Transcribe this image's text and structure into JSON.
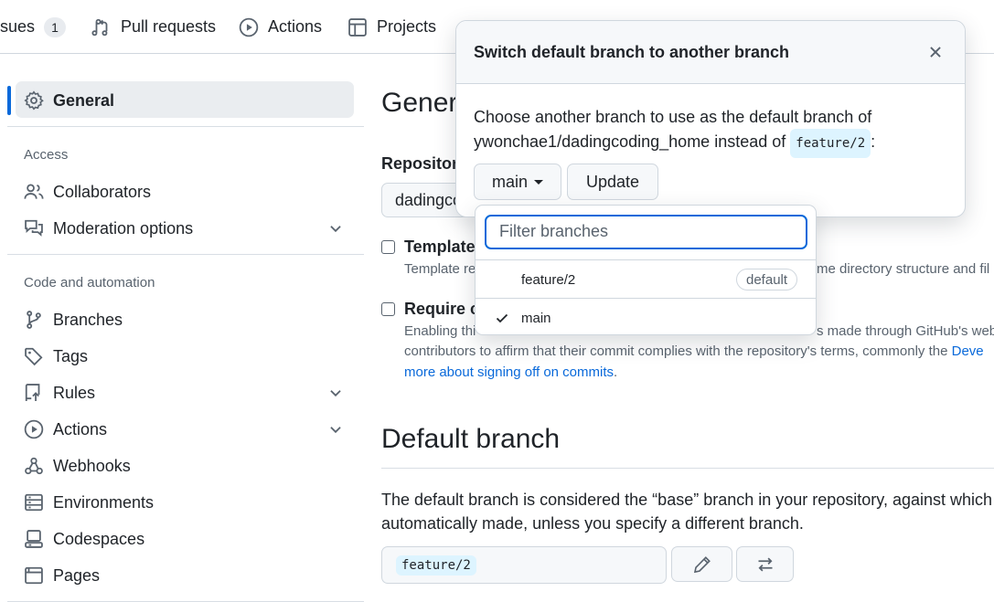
{
  "topnav": {
    "issues_label": "sues",
    "issues_count": "1",
    "pull_requests": "Pull requests",
    "actions": "Actions",
    "projects": "Projects"
  },
  "sidebar": {
    "general": "General",
    "access_heading": "Access",
    "collaborators": "Collaborators",
    "moderation": "Moderation options",
    "code_heading": "Code and automation",
    "branches": "Branches",
    "tags": "Tags",
    "rules": "Rules",
    "actions": "Actions",
    "webhooks": "Webhooks",
    "environments": "Environments",
    "codespaces": "Codespaces",
    "pages": "Pages"
  },
  "main": {
    "general_title": "Gener",
    "repository_label": "Repository",
    "repository_value": "dadingco",
    "template_label": "Template",
    "template_desc_left": "Template re",
    "template_desc_right": "me directory structure and fil",
    "require_label": "Require co",
    "require_desc_line1_left": "Enabling thi",
    "require_desc_line1_right": "s made through GitHub's web",
    "require_desc_line2": "contributors to affirm that their commit complies with the repository's terms, commonly the ",
    "require_desc_line2_link": "Deve",
    "require_desc_line3_link": "more about signing off on commits",
    "require_desc_line3_end": ".",
    "default_branch_title": "Default branch",
    "default_desc_line1": "The default branch is considered the “base” branch in your repository, against which all",
    "default_desc_line2": "automatically made, unless you specify a different branch.",
    "current_default_branch": "feature/2"
  },
  "dialog": {
    "title": "Switch default branch to another branch",
    "text_line1": "Choose another branch to use as the default branch of",
    "text_line2": "ywonchae1/dadingcoding_home instead of ",
    "current_branch": "feature/2",
    "text_end": ":",
    "branch_button": "main",
    "update_button": "Update"
  },
  "dropdown": {
    "filter_placeholder": "Filter branches",
    "items": [
      {
        "name": "feature/2",
        "badge": "default",
        "selected": false
      },
      {
        "name": "main",
        "badge": "",
        "selected": true
      }
    ]
  },
  "colors": {
    "accent": "#0969da",
    "code_bg": "#ddf4ff",
    "muted": "#59636e"
  }
}
